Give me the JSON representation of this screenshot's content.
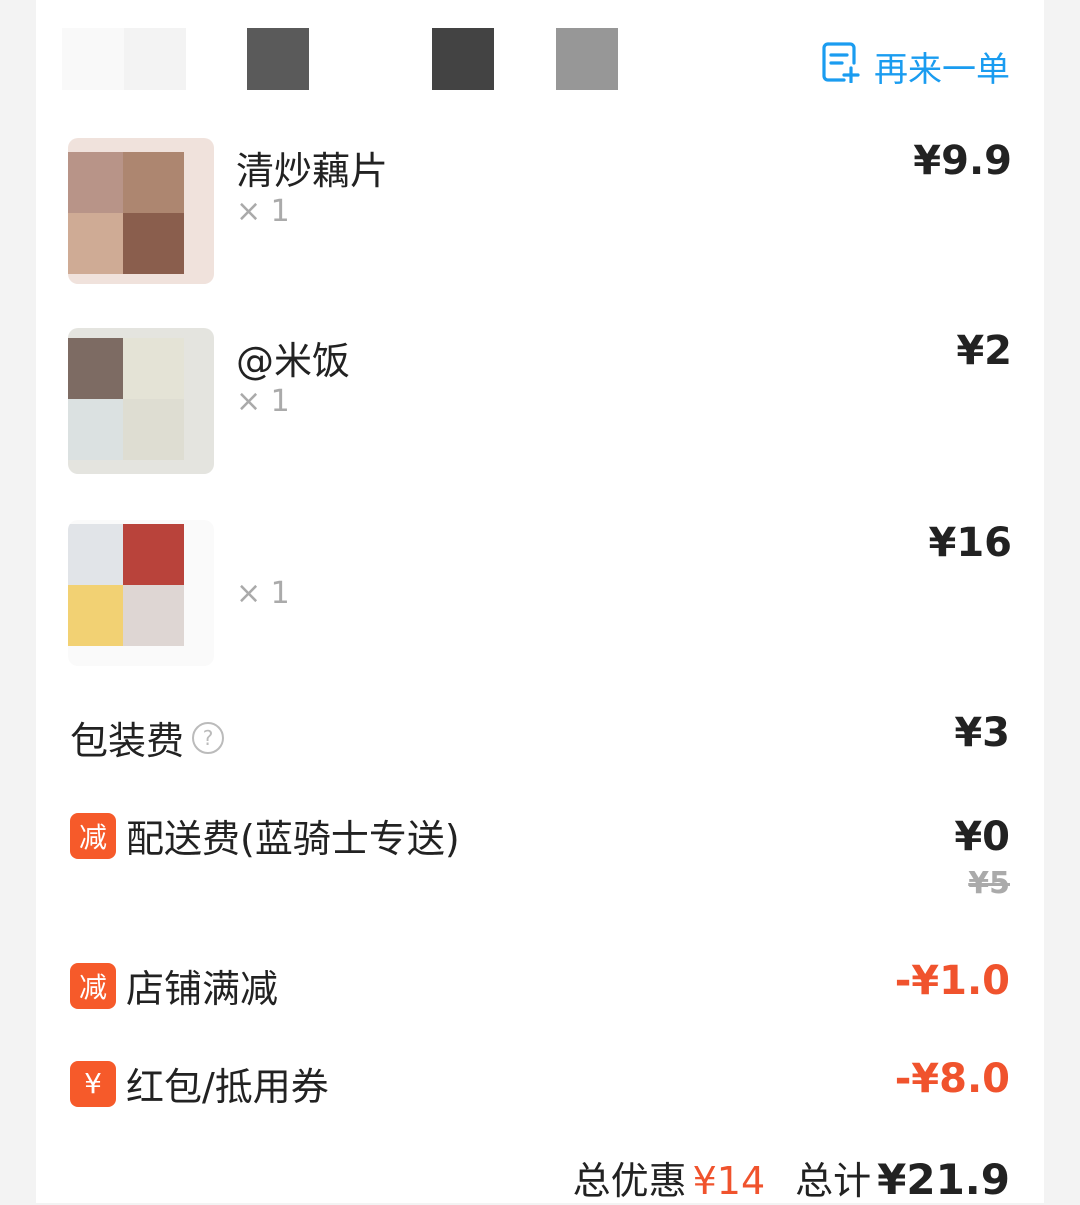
{
  "header": {
    "reorder_label": "再来一单",
    "reorder_icon": "note-add-icon",
    "accent": "#1a9cf0"
  },
  "items": [
    {
      "name": "清炒藕片",
      "qty": "× 1",
      "price": "¥9.9"
    },
    {
      "name": "@米饭",
      "qty": "× 1",
      "price": "¥2"
    },
    {
      "name": "",
      "qty": "× 1",
      "price": "¥16"
    }
  ],
  "fees": {
    "packaging": {
      "label": "包装费",
      "value": "¥3",
      "help_icon": "question-circle-icon",
      "help_glyph": "?"
    },
    "delivery": {
      "tag": "减",
      "label": "配送费(蓝骑士专送)",
      "value": "¥0",
      "original": "¥5"
    },
    "store_discount": {
      "tag": "减",
      "label": "店铺满减",
      "value": "-¥1.0"
    },
    "coupon": {
      "tag": "¥",
      "label": "红包/抵用券",
      "value": "-¥8.0"
    }
  },
  "summary": {
    "discount_label": "总优惠",
    "discount_value": "¥14",
    "total_label": "总计",
    "total_value": "¥21.9"
  },
  "colors": {
    "discount_red": "#f0532d",
    "tag_orange": "#f65a2a"
  }
}
